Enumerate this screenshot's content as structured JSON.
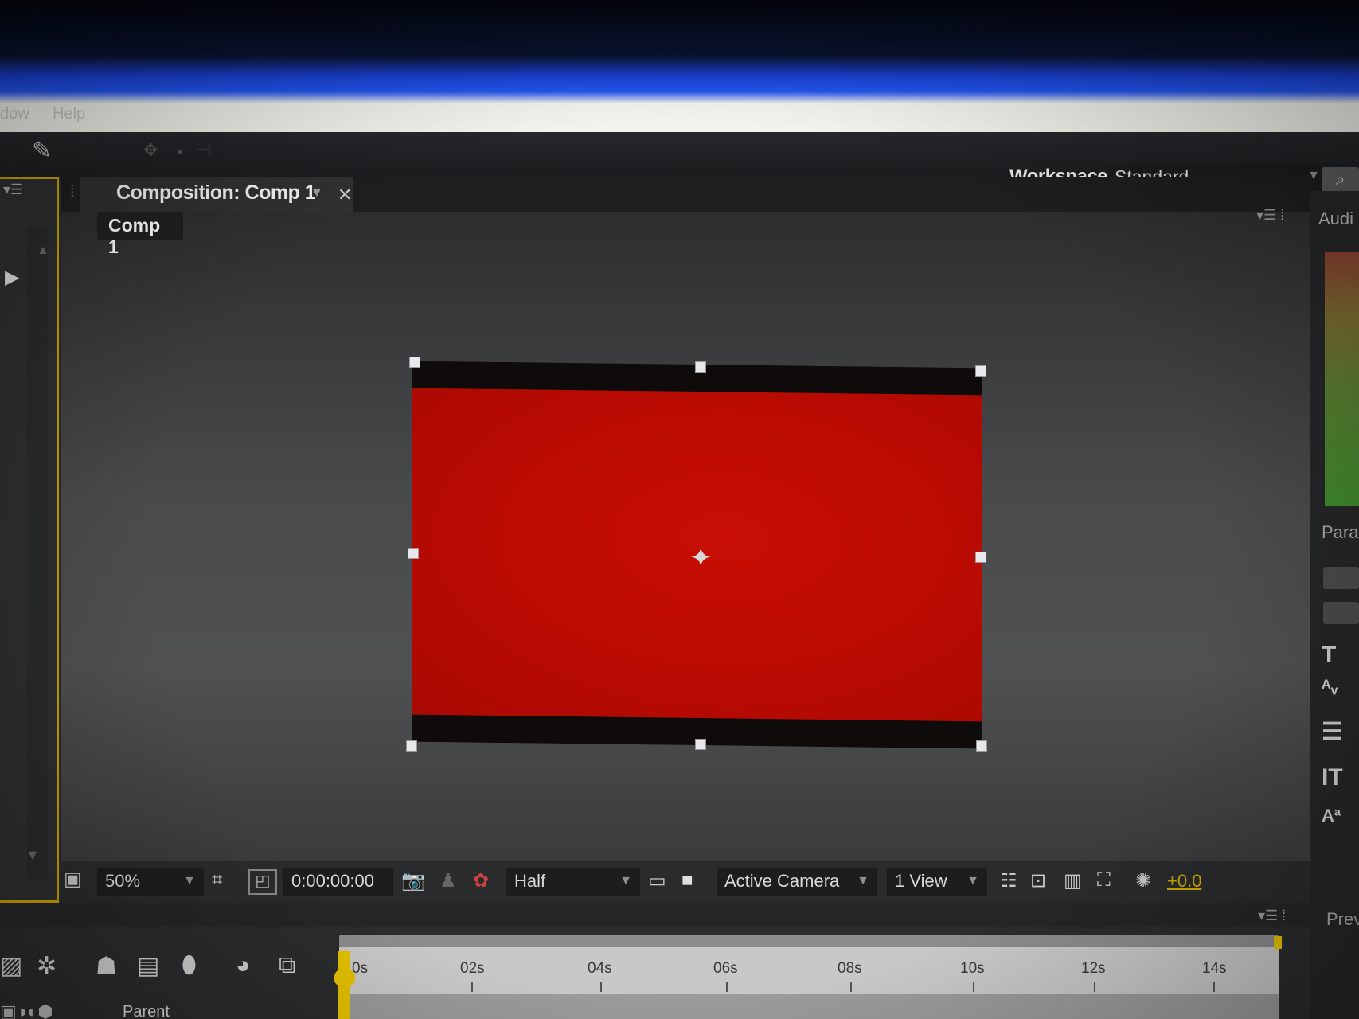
{
  "menubar": {
    "items": [
      "dow",
      "Help"
    ]
  },
  "workspace": {
    "label": "Workspace:",
    "value": "Standard"
  },
  "composition_panel": {
    "tab_title": "Composition: Comp 1",
    "breadcrumb": "Comp 1"
  },
  "comp_footer": {
    "zoom": "50%",
    "timecode": "0:00:00:00",
    "resolution": "Half",
    "camera": "Active Camera",
    "views": "1 View",
    "exposure": "+0.0"
  },
  "right_panel": {
    "audio_tab": "Audi",
    "paragraph_tab": "Para",
    "preview_tab": "Prev"
  },
  "timeline": {
    "ticks": [
      "0s",
      "02s",
      "04s",
      "06s",
      "08s",
      "10s",
      "12s",
      "14s"
    ],
    "parent_label": "Parent"
  },
  "colors": {
    "comp_background": "#bb0b03",
    "accent": "#e6c200",
    "panel_highlight": "#c8a000"
  },
  "icons": [
    "pin-tool-icon",
    "hand-tool-icon",
    "snapshot-icon",
    "color-channels-icon",
    "region-of-interest-icon",
    "transparency-grid-icon",
    "fast-preview-icon",
    "flowchart-icon",
    "search-icon",
    "text-tool-icon",
    "close-icon"
  ]
}
